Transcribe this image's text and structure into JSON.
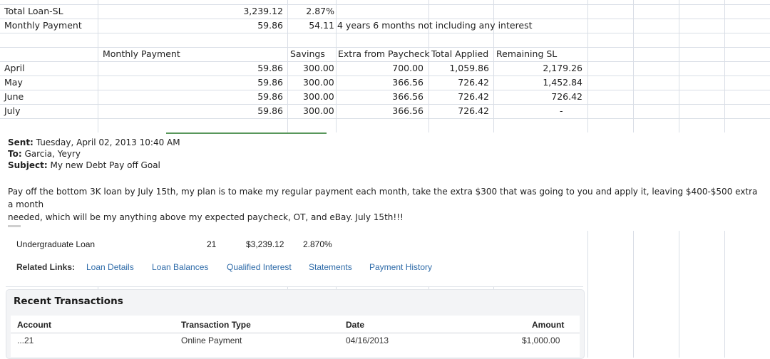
{
  "spreadsheet": {
    "summary": [
      {
        "label": "Total Loan-SL",
        "amount": "3,239.12",
        "rate": "2.87%",
        "note": ""
      },
      {
        "label": "Monthly Payment",
        "amount": "59.86",
        "rate": "54.11",
        "note": "4 years 6 months not including any interest"
      }
    ],
    "headers": {
      "monthly_payment": "Monthly Payment",
      "savings": "Savings",
      "extra": "Extra from Paycheck",
      "total_applied": "Total Applied",
      "remaining": "Remaining SL"
    },
    "rows": [
      {
        "month": "April",
        "payment": "59.86",
        "savings": "300.00",
        "extra": "700.00",
        "total": "1,059.86",
        "remaining": "2,179.26"
      },
      {
        "month": "May",
        "payment": "59.86",
        "savings": "300.00",
        "extra": "366.56",
        "total": "726.42",
        "remaining": "1,452.84"
      },
      {
        "month": "June",
        "payment": "59.86",
        "savings": "300.00",
        "extra": "366.56",
        "total": "726.42",
        "remaining": "726.42"
      },
      {
        "month": "July",
        "payment": "59.86",
        "savings": "300.00",
        "extra": "366.56",
        "total": "726.42",
        "remaining": "-"
      }
    ]
  },
  "email": {
    "sent_label": "Sent:",
    "sent_value": "Tuesday, April 02, 2013 10:40 AM",
    "to_label": "To:",
    "to_value": "Garcia, Yeyry",
    "subject_label": "Subject:",
    "subject_value": "My new Debt Pay off Goal",
    "body_line1": "Pay off the bottom 3K loan by July 15th, my plan is to make my regular payment each month, take the extra $300 that was going to you and apply it, leaving $400-$500 extra a month",
    "body_line2": "needed, which will be my anything above my expected paycheck, OT, and eBay.  July 15th!!!"
  },
  "bank": {
    "loan_name": "Undergraduate Loan",
    "loan_number": "21",
    "loan_balance": "$3,239.12",
    "loan_rate": "2.870%",
    "related_label": "Related Links:",
    "links": [
      "Loan Details",
      "Loan Balances",
      "Qualified Interest",
      "Statements",
      "Payment History"
    ],
    "recent_title": "Recent Transactions",
    "columns": [
      "Account",
      "Transaction Type",
      "Date",
      "Amount"
    ],
    "transaction": {
      "account": "...21",
      "type": "Online Payment",
      "date": "04/16/2013",
      "amount": "$1,000.00"
    }
  }
}
